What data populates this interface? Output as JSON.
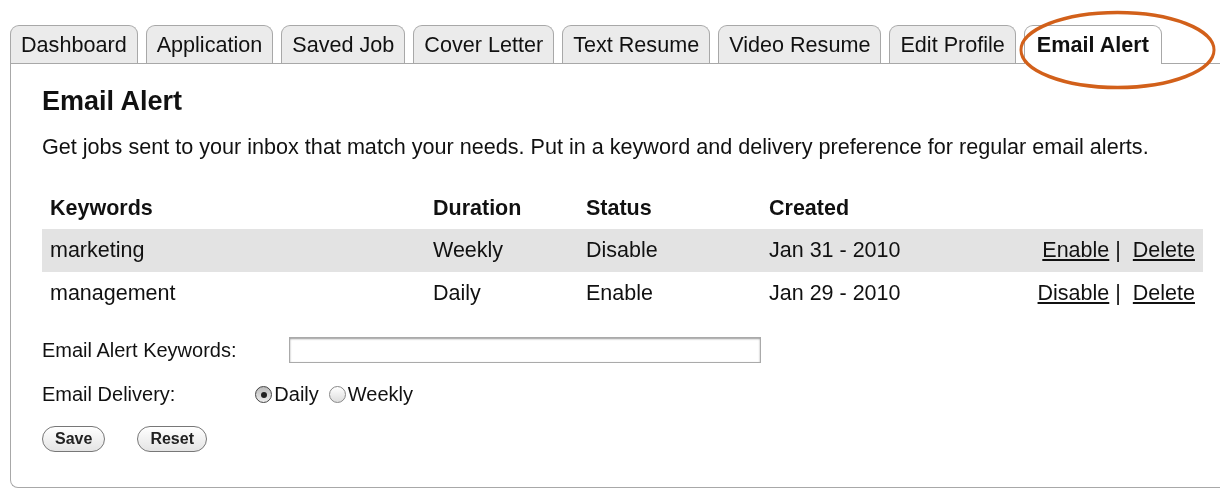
{
  "tabs": [
    {
      "label": "Dashboard",
      "selected": false
    },
    {
      "label": "Application",
      "selected": false
    },
    {
      "label": "Saved Job",
      "selected": false
    },
    {
      "label": "Cover Letter",
      "selected": false
    },
    {
      "label": "Text Resume",
      "selected": false
    },
    {
      "label": "Video Resume",
      "selected": false
    },
    {
      "label": "Edit Profile",
      "selected": false
    },
    {
      "label": "Email Alert",
      "selected": true
    }
  ],
  "heading": "Email Alert",
  "description": "Get jobs sent to your inbox that match your needs. Put in a keyword and delivery preference for regular email alerts.",
  "table": {
    "columns": [
      "Keywords",
      "Duration",
      "Status",
      "Created"
    ],
    "rows": [
      {
        "keyword": "marketing",
        "duration": "Weekly",
        "status": "Disable",
        "created": "Jan 31 - 2010",
        "actions": [
          "Enable",
          "Delete"
        ],
        "separator": "|"
      },
      {
        "keyword": "management",
        "duration": "Daily",
        "status": "Enable",
        "created": "Jan 29 - 2010",
        "actions": [
          "Disable",
          "Delete"
        ],
        "separator": "|"
      }
    ]
  },
  "form": {
    "keywords_label": "Email Alert Keywords:",
    "delivery_label": "Email Delivery:",
    "delivery_options": [
      {
        "label": "Daily",
        "selected": true
      },
      {
        "label": "Weekly",
        "selected": false
      }
    ],
    "buttons": [
      "Save",
      "Reset"
    ]
  }
}
